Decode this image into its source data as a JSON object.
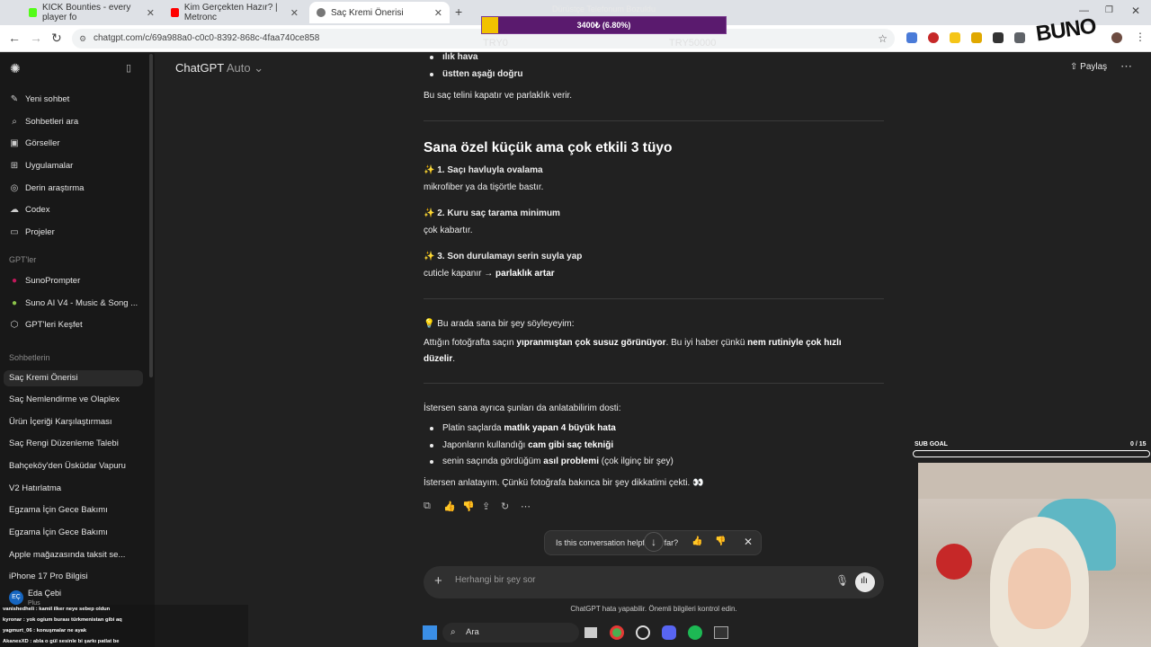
{
  "browser": {
    "tabs": [
      {
        "title": "KICK Bounties - every player fo",
        "color": "#53fc18"
      },
      {
        "title": "Kim Gerçekten Hazır? | Metronc",
        "color": "#ff0000"
      },
      {
        "title": "Saç Kremi Önerisi",
        "color": "#777777",
        "active": true
      }
    ],
    "new_tab": "+",
    "url": "chatgpt.com/c/69a988a0-c0c0-8392-868c-4faa740ce858"
  },
  "stream_overlay": {
    "title": "Dürüstçe Telefonum Bozuldu",
    "progress_text": "3400₺ (6.80%)",
    "progress_fraction": 0.068,
    "min_label": "TRY0",
    "max_label": "TRY50000",
    "brand": "BUNO",
    "sub_goal_label": "SUB GOAL",
    "sub_goal_value": "0 / 15",
    "sub_goal_fraction": 0
  },
  "sidebar": {
    "items": [
      {
        "label": "Yeni sohbet",
        "icon": "edit-icon"
      },
      {
        "label": "Sohbetleri ara",
        "icon": "search-icon"
      },
      {
        "label": "Görseller",
        "icon": "image-icon"
      },
      {
        "label": "Uygulamalar",
        "icon": "apps-icon"
      },
      {
        "label": "Derin araştırma",
        "icon": "research-icon"
      },
      {
        "label": "Codex",
        "icon": "codex-icon"
      },
      {
        "label": "Projeler",
        "icon": "folder-icon"
      }
    ],
    "gpts_heading": "GPT'ler",
    "gpts": [
      {
        "label": "SunoPrompter"
      },
      {
        "label": "Suno AI V4 - Music & Song ..."
      },
      {
        "label": "GPT'leri Keşfet"
      }
    ],
    "chats_heading": "Sohbetlerin",
    "chats": [
      "Saç Kremi Önerisi",
      "Saç Nemlendirme ve Olaplex",
      "Ürün İçeriği Karşılaştırması",
      "Saç Rengi Düzenleme Talebi",
      "Bahçeköy'den Üsküdar Vapuru",
      "V2 Hatırlatma",
      "Egzama İçin Gece Bakımı",
      "Egzama İçin Gece Bakımı",
      "Apple mağazasında taksit se...",
      "iPhone 17 Pro Bilgisi"
    ],
    "user_name": "Eda Çebi",
    "user_initials": "EÇ",
    "user_plan": "Plus"
  },
  "header": {
    "model": "ChatGPT",
    "model_sub": "Auto",
    "share": "Paylaş"
  },
  "message": {
    "top_bullets": [
      "ılık hava",
      "üstten aşağı doğru"
    ],
    "top_para": "Bu saç telini kapatır ve parlaklık verir.",
    "heading": "Sana özel küçük ama çok etkili 3 tüyo",
    "tips": [
      {
        "title": "✨ 1. Saçı havluyla ovalama",
        "body": "mikrofiber ya da tişörtle bastır."
      },
      {
        "title": "✨ 2. Kuru saç tarama minimum",
        "body": "çok kabartır."
      },
      {
        "title": "✨ 3. Son durulamayı serin suyla yap",
        "body_prefix": "cuticle kapanır → ",
        "body_bold": "parlaklık artar"
      }
    ],
    "note_title": "💡 Bu arada sana bir şey söyleyeyim:",
    "note_p1": "Attığın fotoğrafta saçın ",
    "note_b1": "yıpranmıştan çok susuz görünüyor",
    "note_p2": ". Bu iyi haber çünkü ",
    "note_b2": "nem rutiniyle çok hızlı",
    "note_b3": "düzelir",
    "note_p3": ".",
    "offer_intro": "İstersen sana ayrıca şunları da anlatabilirim dosti:",
    "offers": [
      {
        "pre": "Platin saçlarda ",
        "bold": "matlık yapan 4 büyük hata",
        "post": ""
      },
      {
        "pre": "Japonların kullandığı ",
        "bold": "cam gibi saç tekniği",
        "post": ""
      },
      {
        "pre": "senin saçında gördüğüm ",
        "bold": "asıl problemi",
        "post": " (çok ilginç bir şey)"
      }
    ],
    "closing": "İstersen anlatayım. Çünkü fotoğrafa bakınca bir şey dikkatimi çekti. 👀"
  },
  "feedback": {
    "text": "Is this conversation helpful so far?"
  },
  "composer": {
    "placeholder": "Herhangi bir şey sor"
  },
  "disclaimer": "ChatGPT hata yapabilir. Önemli bilgileri kontrol edin.",
  "taskbar": {
    "search": "Ara"
  },
  "chat_overlay": [
    "vanishedheli : kamil ilker neye sebep oldun",
    "kyronar : yok ogium burası türkmenistan gibi aq",
    "yagmurt_06 : konuşmalar ne ayak",
    "AkanesXD : abla o gül sesinle bi şarkı patlat be"
  ]
}
